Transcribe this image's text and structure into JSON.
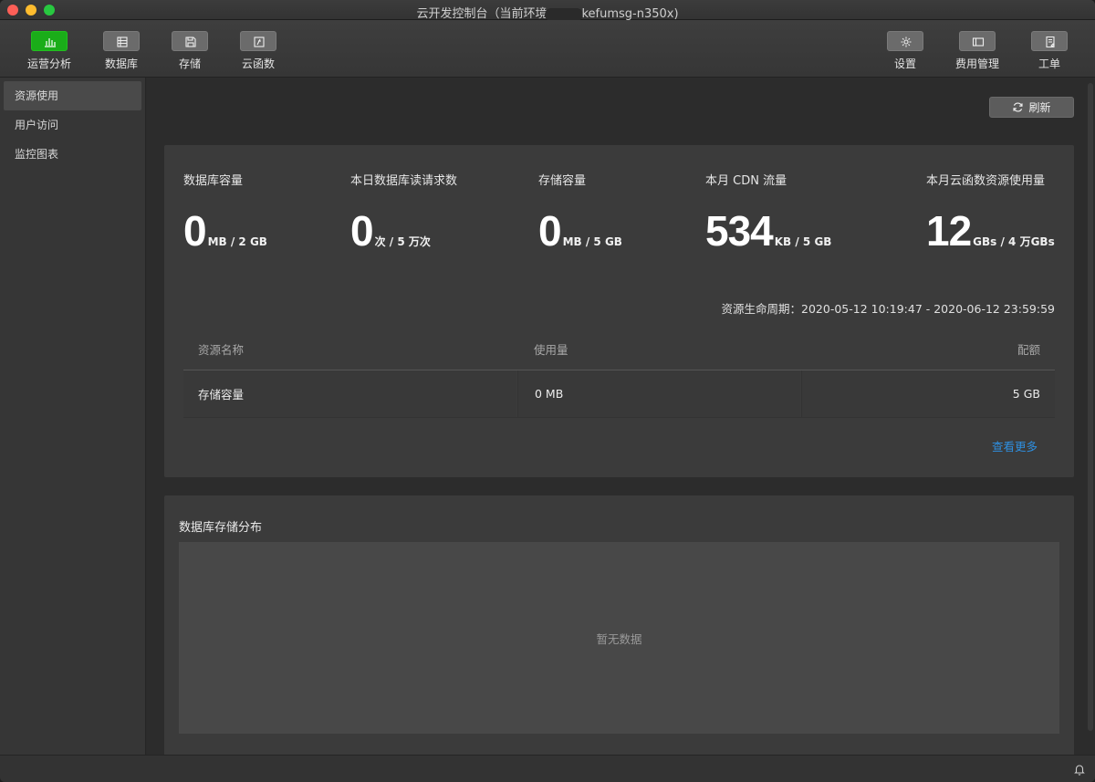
{
  "window": {
    "title_prefix": "云开发控制台（当前环境",
    "title_suffix": "kefumsg-n350x)"
  },
  "toolbar": {
    "left": [
      {
        "label": "运营分析",
        "icon": "bar-chart-icon",
        "active": true
      },
      {
        "label": "数据库",
        "icon": "database-icon",
        "active": false
      },
      {
        "label": "存储",
        "icon": "save-icon",
        "active": false
      },
      {
        "label": "云函数",
        "icon": "function-icon",
        "active": false
      }
    ],
    "right": [
      {
        "label": "设置",
        "icon": "gear-icon"
      },
      {
        "label": "费用管理",
        "icon": "billing-icon"
      },
      {
        "label": "工单",
        "icon": "ticket-icon"
      }
    ]
  },
  "sidebar": {
    "items": [
      {
        "label": "资源使用",
        "active": true
      },
      {
        "label": "用户访问",
        "active": false
      },
      {
        "label": "监控图表",
        "active": false
      }
    ]
  },
  "main": {
    "refresh_label": "刷新",
    "stats": [
      {
        "label": "数据库容量",
        "value": "0",
        "unit": "MB / 2 GB"
      },
      {
        "label": "本日数据库读请求数",
        "value": "0",
        "unit": "次 / 5 万次"
      },
      {
        "label": "存储容量",
        "value": "0",
        "unit": "MB / 5 GB"
      },
      {
        "label": "本月 CDN 流量",
        "value": "534",
        "unit": "KB / 5 GB"
      },
      {
        "label": "本月云函数资源使用量",
        "value": "12",
        "unit": "GBs / 4 万GBs"
      }
    ],
    "lifecycle": "资源生命周期：2020-05-12 10:19:47 - 2020-06-12 23:59:59",
    "table": {
      "headers": [
        "资源名称",
        "使用量",
        "配额"
      ],
      "rows": [
        [
          "存储容量",
          "0 MB",
          "5 GB"
        ]
      ]
    },
    "more_link": "查看更多",
    "distribution": {
      "title": "数据库存储分布",
      "empty_text": "暂无数据"
    }
  },
  "colors": {
    "accent_green": "#1aad19",
    "link_blue": "#2e8fe0"
  }
}
